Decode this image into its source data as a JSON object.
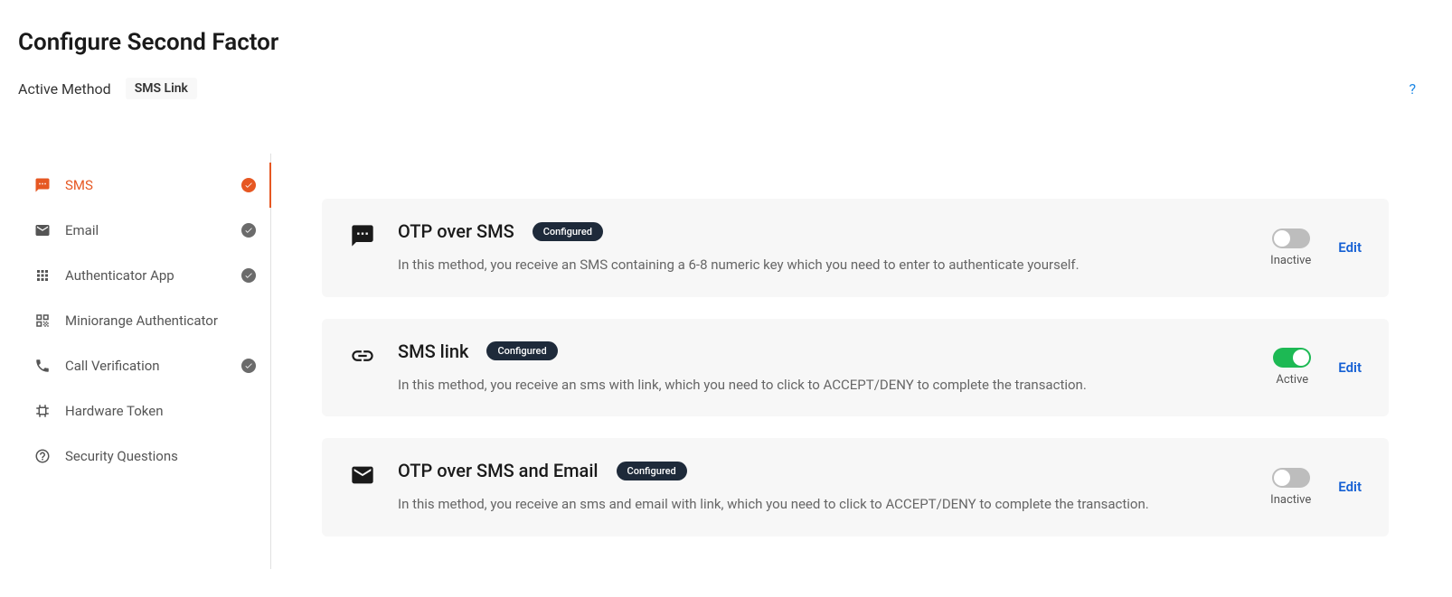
{
  "page": {
    "title": "Configure Second Factor",
    "activeMethodLabel": "Active Method",
    "activeMethodValue": "SMS Link",
    "helpIcon": "?"
  },
  "sidebar": {
    "items": [
      {
        "label": "SMS",
        "icon": "sms",
        "active": true,
        "configured": true
      },
      {
        "label": "Email",
        "icon": "email",
        "active": false,
        "configured": true
      },
      {
        "label": "Authenticator App",
        "icon": "grid",
        "active": false,
        "configured": true
      },
      {
        "label": "Miniorange Authenticator",
        "icon": "qr",
        "active": false,
        "configured": false
      },
      {
        "label": "Call Verification",
        "icon": "phone",
        "active": false,
        "configured": true
      },
      {
        "label": "Hardware Token",
        "icon": "token",
        "active": false,
        "configured": false
      },
      {
        "label": "Security Questions",
        "icon": "question",
        "active": false,
        "configured": false
      }
    ]
  },
  "methods": [
    {
      "title": "OTP over SMS",
      "badge": "Configured",
      "description": "In this method, you receive an SMS containing a 6-8 numeric key which you need to enter to authenticate yourself.",
      "icon": "sms-bubble",
      "active": false,
      "toggleLabel": "Inactive",
      "editLabel": "Edit"
    },
    {
      "title": "SMS link",
      "badge": "Configured",
      "description": "In this method, you receive an sms with link, which you need to click to ACCEPT/DENY to complete the transaction.",
      "icon": "link",
      "active": true,
      "toggleLabel": "Active",
      "editLabel": "Edit"
    },
    {
      "title": "OTP over SMS and Email",
      "badge": "Configured",
      "description": "In this method, you receive an sms and email with link, which you need to click to ACCEPT/DENY to complete the transaction.",
      "icon": "envelope",
      "active": false,
      "toggleLabel": "Inactive",
      "editLabel": "Edit"
    }
  ]
}
